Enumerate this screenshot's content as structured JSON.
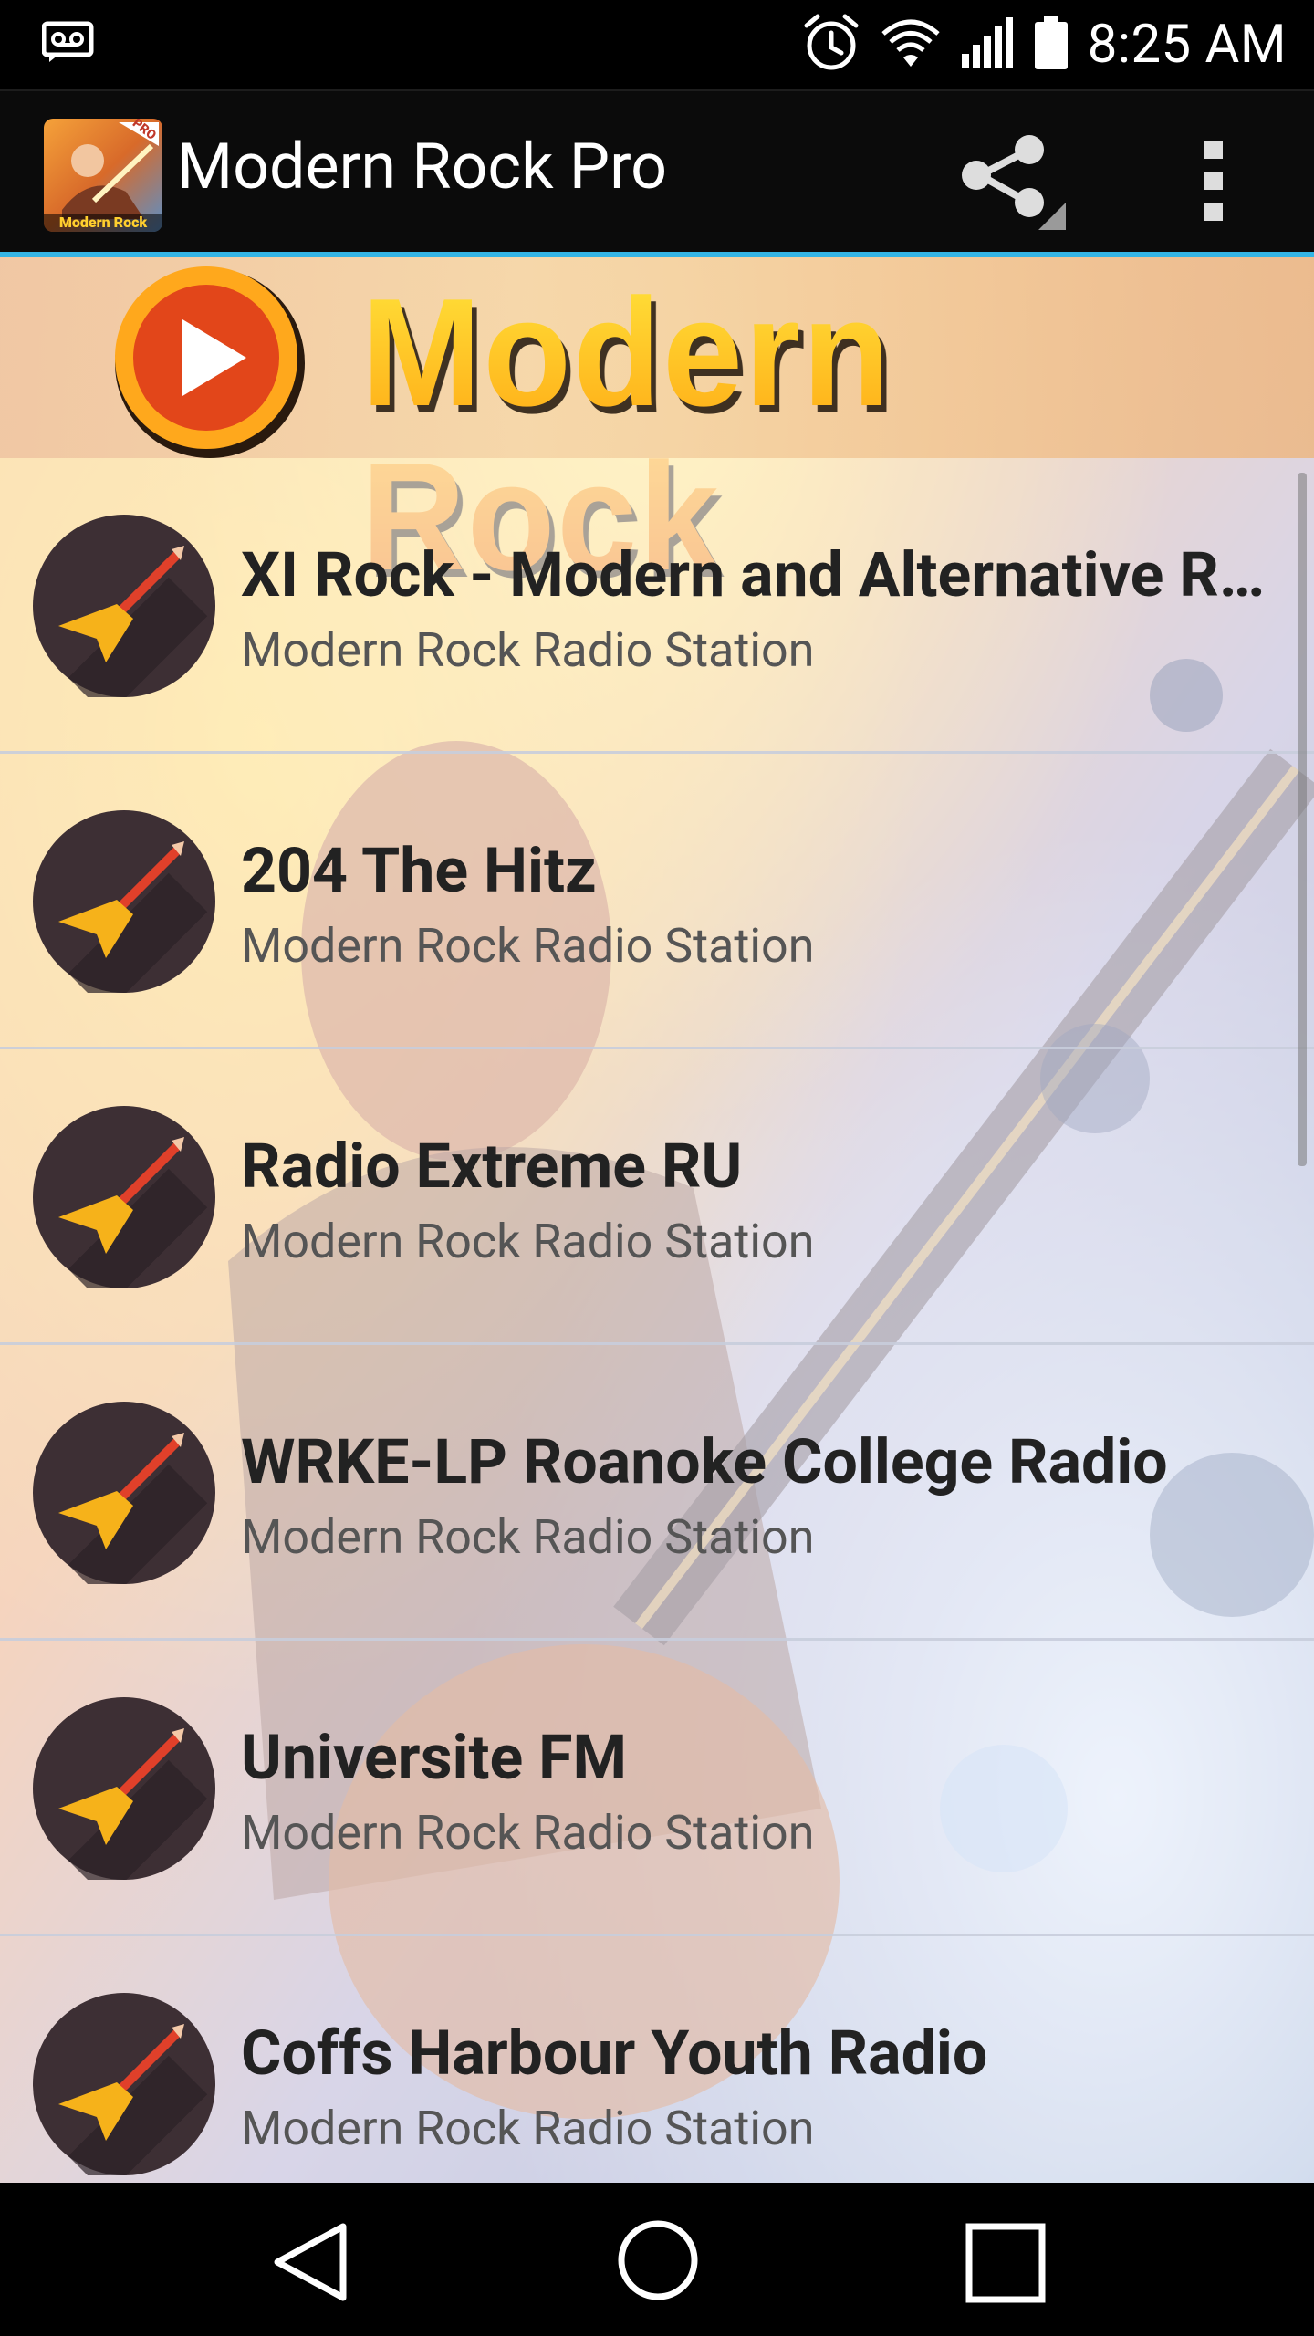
{
  "status_bar": {
    "time": "8:25 AM",
    "icons": [
      "voicemail-icon",
      "alarm-icon",
      "wifi-icon",
      "signal-icon",
      "battery-icon"
    ]
  },
  "action_bar": {
    "app_icon_badge": "PRO",
    "app_icon_caption": "Modern Rock",
    "title": "Modern Rock Pro",
    "share_icon": "share-icon",
    "overflow_icon": "overflow-menu-icon"
  },
  "banner": {
    "title": "Modern Rock",
    "play_icon": "play-icon"
  },
  "stations": [
    {
      "name": "XI Rock - Modern and Alternative Rock",
      "subtitle": "Modern Rock Radio Station"
    },
    {
      "name": "204 The Hitz",
      "subtitle": "Modern Rock Radio Station"
    },
    {
      "name": "Radio Extreme RU",
      "subtitle": "Modern Rock Radio Station"
    },
    {
      "name": "WRKE-LP Roanoke College Radio",
      "subtitle": "Modern Rock Radio Station"
    },
    {
      "name": "Universite FM",
      "subtitle": "Modern Rock Radio Station"
    },
    {
      "name": "Coffs Harbour Youth Radio",
      "subtitle": "Modern Rock Radio Station"
    }
  ],
  "nav_bar": {
    "back_icon": "back-icon",
    "home_icon": "home-icon",
    "recents_icon": "recents-icon"
  },
  "colors": {
    "accent": "#35b5e5",
    "banner_orange": "#f0840f",
    "icon_circle": "#3d2f34",
    "guitar_yellow": "#f6b21a",
    "guitar_neck": "#e0402a"
  }
}
